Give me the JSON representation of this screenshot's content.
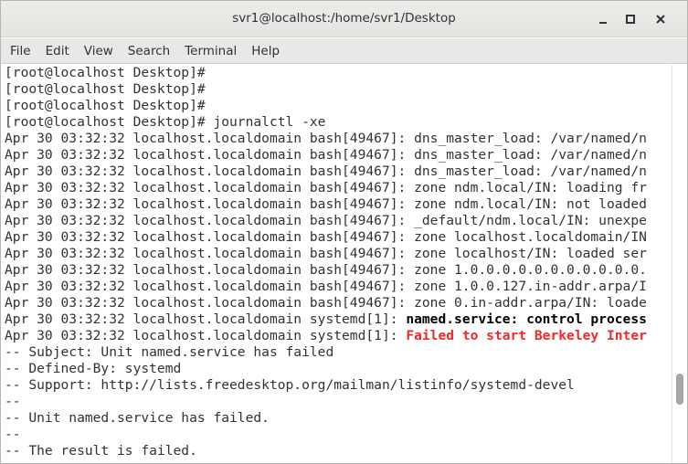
{
  "window": {
    "title": "svr1@localhost:/home/svr1/Desktop",
    "minimize_icon": "minimize-icon",
    "maximize_icon": "maximize-icon",
    "close_icon": "close-icon"
  },
  "menubar": {
    "items": [
      "File",
      "Edit",
      "View",
      "Search",
      "Terminal",
      "Help"
    ]
  },
  "terminal": {
    "lines": [
      {
        "plain": "[root@localhost Desktop]#",
        "bold": "",
        "red": ""
      },
      {
        "plain": "[root@localhost Desktop]#",
        "bold": "",
        "red": ""
      },
      {
        "plain": "[root@localhost Desktop]#",
        "bold": "",
        "red": ""
      },
      {
        "plain": "[root@localhost Desktop]# journalctl -xe",
        "bold": "",
        "red": ""
      },
      {
        "plain": "Apr 30 03:32:32 localhost.localdomain bash[49467]: dns_master_load: /var/named/n",
        "bold": "",
        "red": ""
      },
      {
        "plain": "Apr 30 03:32:32 localhost.localdomain bash[49467]: dns_master_load: /var/named/n",
        "bold": "",
        "red": ""
      },
      {
        "plain": "Apr 30 03:32:32 localhost.localdomain bash[49467]: dns_master_load: /var/named/n",
        "bold": "",
        "red": ""
      },
      {
        "plain": "Apr 30 03:32:32 localhost.localdomain bash[49467]: zone ndm.local/IN: loading fr",
        "bold": "",
        "red": ""
      },
      {
        "plain": "Apr 30 03:32:32 localhost.localdomain bash[49467]: zone ndm.local/IN: not loaded",
        "bold": "",
        "red": ""
      },
      {
        "plain": "Apr 30 03:32:32 localhost.localdomain bash[49467]: _default/ndm.local/IN: unexpe",
        "bold": "",
        "red": ""
      },
      {
        "plain": "Apr 30 03:32:32 localhost.localdomain bash[49467]: zone localhost.localdomain/IN",
        "bold": "",
        "red": ""
      },
      {
        "plain": "Apr 30 03:32:32 localhost.localdomain bash[49467]: zone localhost/IN: loaded ser",
        "bold": "",
        "red": ""
      },
      {
        "plain": "Apr 30 03:32:32 localhost.localdomain bash[49467]: zone 1.0.0.0.0.0.0.0.0.0.0.0.",
        "bold": "",
        "red": ""
      },
      {
        "plain": "Apr 30 03:32:32 localhost.localdomain bash[49467]: zone 1.0.0.127.in-addr.arpa/I",
        "bold": "",
        "red": ""
      },
      {
        "plain": "Apr 30 03:32:32 localhost.localdomain bash[49467]: zone 0.in-addr.arpa/IN: loade",
        "bold": "",
        "red": ""
      },
      {
        "plain": "Apr 30 03:32:32 localhost.localdomain systemd[1]: ",
        "bold": "named.service: control process",
        "red": ""
      },
      {
        "plain": "Apr 30 03:32:32 localhost.localdomain systemd[1]: ",
        "bold": "",
        "red": "Failed to start Berkeley Inter"
      },
      {
        "plain": "-- Subject: Unit named.service has failed",
        "bold": "",
        "red": ""
      },
      {
        "plain": "-- Defined-By: systemd",
        "bold": "",
        "red": ""
      },
      {
        "plain": "-- Support: http://lists.freedesktop.org/mailman/listinfo/systemd-devel",
        "bold": "",
        "red": ""
      },
      {
        "plain": "--",
        "bold": "",
        "red": ""
      },
      {
        "plain": "-- Unit named.service has failed.",
        "bold": "",
        "red": ""
      },
      {
        "plain": "--",
        "bold": "",
        "red": ""
      },
      {
        "plain": "-- The result is failed.",
        "bold": "",
        "red": ""
      }
    ]
  },
  "colors": {
    "text": "#2e3436",
    "error_red": "#ef2929",
    "background": "#ffffff",
    "chrome": "#e8e8e7"
  }
}
